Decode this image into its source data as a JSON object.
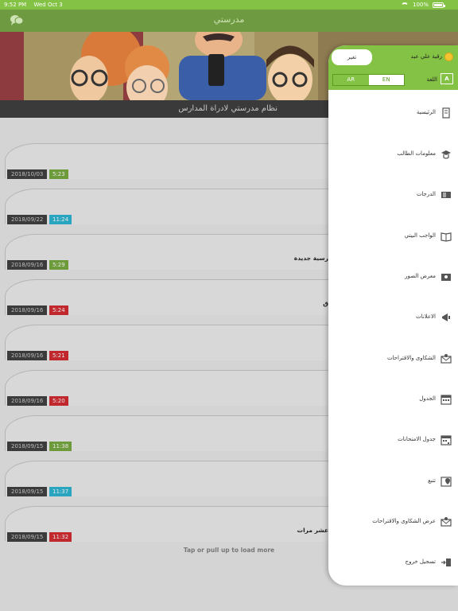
{
  "status_bar": {
    "time": "9:52 PM",
    "date": "Wed Oct 3",
    "battery": "100%"
  },
  "app": {
    "title": "مدرستي",
    "banner_caption": "نظام مدرستي لادراة المدارس"
  },
  "drawer": {
    "user_name": "رقية علي عبد",
    "change_button": "تغير",
    "language_label": "اللغة",
    "lang_en": "EN",
    "lang_ar": "AR",
    "menu": [
      {
        "label": "الرئيسية",
        "icon": "home-icon"
      },
      {
        "label": "معلومات الطالب",
        "icon": "graduation-cap-icon"
      },
      {
        "label": "الدرجات",
        "icon": "grades-icon"
      },
      {
        "label": "الواجب البيتي",
        "icon": "book-icon"
      },
      {
        "label": "معرض الصور",
        "icon": "photo-icon"
      },
      {
        "label": "الاعلانات",
        "icon": "megaphone-icon"
      },
      {
        "label": "الشكاوى والاقتراحات",
        "icon": "mail-icon"
      },
      {
        "label": "الجدول",
        "icon": "calendar-icon"
      },
      {
        "label": "جدول الامتحانات",
        "icon": "exam-calendar-icon"
      },
      {
        "label": "تتبع",
        "icon": "map-marker-icon"
      },
      {
        "label": "عرض الشكاوى والاقتراحات",
        "icon": "view-mail-icon"
      },
      {
        "label": "تسجيل خروج",
        "icon": "logout-icon"
      }
    ]
  },
  "notifications": [
    {
      "date": "2018/10/03",
      "time": "5:23",
      "color": "#6d9a3a",
      "text": ""
    },
    {
      "date": "2018/09/22",
      "time": "11:24",
      "color": "#2aa5c0",
      "text": ""
    },
    {
      "date": "2018/09/16",
      "time": "5:29",
      "color": "#6d9a3a",
      "text": "رسية جديدة"
    },
    {
      "date": "2018/09/16",
      "time": "5:24",
      "color": "#c0282d",
      "text": "ق"
    },
    {
      "date": "2018/09/16",
      "time": "5:21",
      "color": "#c0282d",
      "text": ""
    },
    {
      "date": "2018/09/16",
      "time": "5:20",
      "color": "#c0282d",
      "text": ""
    },
    {
      "date": "2018/09/15",
      "time": "11:38",
      "color": "#6d9a3a",
      "text": ""
    },
    {
      "date": "2018/09/15",
      "time": "11:37",
      "color": "#2aa5c0",
      "text": ""
    },
    {
      "date": "2018/09/15",
      "time": "11:32",
      "color": "#c0282d",
      "text": "عشر مرات"
    }
  ],
  "load_more": "Tap or pull up to load more"
}
